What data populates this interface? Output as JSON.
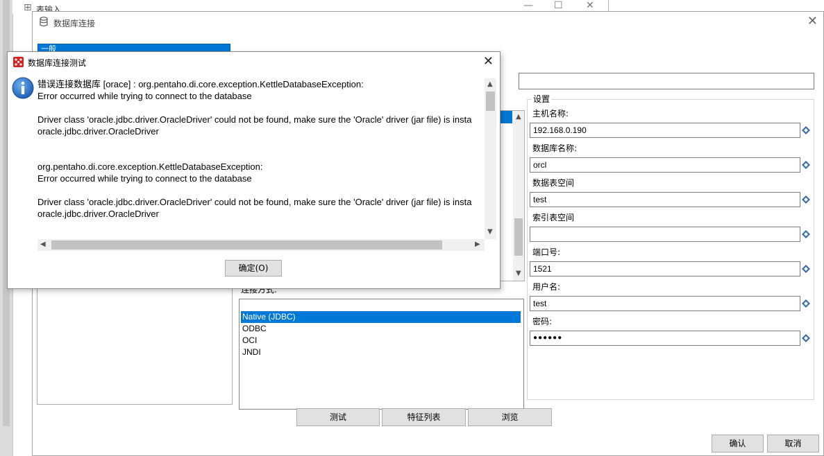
{
  "background_window": {
    "title": "表输入",
    "controls": [
      "—",
      "☐",
      "✕"
    ]
  },
  "main_dialog": {
    "title": "数据库连接",
    "close_glyph": "✕",
    "tabs": [
      {
        "label": "一般",
        "selected": true
      }
    ],
    "access_label": "连接方式:",
    "access_options": [
      "Native (JDBC)",
      "ODBC",
      "OCI",
      "JNDI"
    ],
    "access_selected": "Native (JDBC)",
    "settings": {
      "group_title": "设置",
      "host_label": "主机名称:",
      "host_value": "192.168.0.190",
      "db_label": "数据库名称:",
      "db_value": "orcl",
      "tablespace_label": "数据表空间",
      "tablespace_value": "test",
      "index_tablespace_label": "索引表空间",
      "index_tablespace_value": "",
      "port_label": "端口号:",
      "port_value": "1521",
      "user_label": "用户名:",
      "user_value": "test",
      "password_label": "密码:",
      "password_value": "●●●●●●"
    },
    "buttons": {
      "test": "测试",
      "features": "特征列表",
      "explore": "浏览",
      "ok": "确认",
      "cancel": "取消"
    }
  },
  "error_dialog": {
    "title": "数据库连接测试",
    "close_glyph": "✕",
    "message_lines": [
      "错误连接数据库 [orace] : org.pentaho.di.core.exception.KettleDatabaseException:",
      "Error occurred while trying to connect to the database",
      "",
      "Driver class 'oracle.jdbc.driver.OracleDriver' could not be found, make sure the 'Oracle' driver (jar file) is insta",
      "oracle.jdbc.driver.OracleDriver",
      "",
      "",
      "org.pentaho.di.core.exception.KettleDatabaseException:",
      "Error occurred while trying to connect to the database",
      "",
      "Driver class 'oracle.jdbc.driver.OracleDriver' could not be found, make sure the 'Oracle' driver (jar file) is insta",
      "oracle.jdbc.driver.OracleDriver"
    ],
    "ok_label": "确定(O)"
  },
  "colors": {
    "accent": "#0078d7",
    "error_icon": "#d9211e",
    "info_icon": "#1e6fc9",
    "diamond_icon": "#3a6ea5"
  }
}
